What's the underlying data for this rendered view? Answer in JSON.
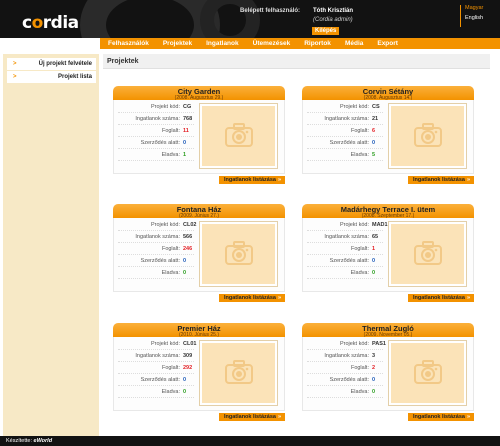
{
  "header": {
    "logo_prefix": "c",
    "logo_o": "o",
    "logo_suffix": "rdia",
    "logged_in_label": "Belépett felhasználó:",
    "user_name": "Tóth Krisztián",
    "user_role": "(Cordia admin)",
    "logout_label": "Kilépés",
    "languages": [
      "Magyar",
      "English"
    ]
  },
  "menu": [
    "Felhasználók",
    "Projektek",
    "Ingatlanok",
    "Ütemezések",
    "Riportok",
    "Média",
    "Export"
  ],
  "sidebar": {
    "items": [
      {
        "label": "Új projekt felvétele",
        "icon": "arrow-right-icon"
      },
      {
        "label": "Projekt lista",
        "icon": "arrow-right-icon"
      }
    ]
  },
  "page": {
    "title": "Projektek"
  },
  "field_labels": {
    "code": "Projekt kód:",
    "count": "Ingatlanok száma:",
    "reserved": "Foglalt:",
    "contract": "Szerződés alatt:",
    "sold": "Eladva:"
  },
  "list_button_label": "Ingatlanok listázása",
  "list_button_chevron": "»",
  "colors": {
    "accent": "#f39200",
    "reserved": "#e31e24",
    "contract": "#1d5ab8",
    "sold": "#2a9d1f"
  },
  "projects": [
    {
      "name": "City Garden",
      "date": "(2008. Augusztus 29.)",
      "code": "CG",
      "count": "768",
      "reserved": "11",
      "contract": "0",
      "sold": "1",
      "image": "camera-placeholder-icon"
    },
    {
      "name": "Corvin Sétány",
      "date": "(2008. Augusztus 14.)",
      "code": "CS",
      "count": "21",
      "reserved": "6",
      "contract": "0",
      "sold": "5",
      "image": "camera-placeholder-icon"
    },
    {
      "name": "Fontana Ház",
      "date": "(2009. Június 27.)",
      "code": "CL02",
      "count": "566",
      "reserved": "246",
      "contract": "0",
      "sold": "0",
      "image": "camera-placeholder-icon"
    },
    {
      "name": "Madárhegy Terrace I. ütem",
      "date": "(2008. Szeptember 17.)",
      "code": "MAD1",
      "count": "65",
      "reserved": "1",
      "contract": "0",
      "sold": "0",
      "image": "camera-placeholder-icon"
    },
    {
      "name": "Premier Ház",
      "date": "(2010. Június 25.)",
      "code": "CL01",
      "count": "309",
      "reserved": "292",
      "contract": "0",
      "sold": "0",
      "image": "camera-placeholder-icon"
    },
    {
      "name": "Thermal Zugló",
      "date": "(2009. November 05.)",
      "code": "PAS1",
      "count": "3",
      "reserved": "2",
      "contract": "0",
      "sold": "0",
      "image": "camera-placeholder-icon"
    }
  ],
  "footer": {
    "credit_label": "Készítette:",
    "credit_name": "eWorld"
  }
}
